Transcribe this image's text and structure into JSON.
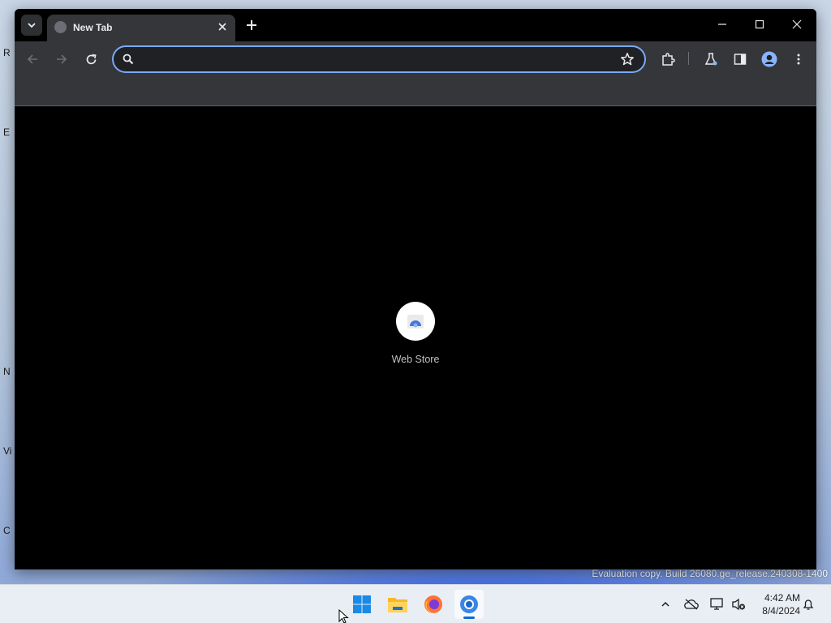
{
  "browser": {
    "tab": {
      "title": "New Tab"
    },
    "omnibox": {
      "value": "",
      "placeholder": ""
    },
    "shortcuts": [
      {
        "label": "Web Store",
        "icon": "web-store-icon"
      }
    ]
  },
  "desktop": {
    "icon_fragments": [
      "R",
      "E",
      "N",
      "Vi",
      "C"
    ],
    "watermark": "Evaluation copy. Build 26080.ge_release.240308-1400"
  },
  "taskbar": {
    "apps": [
      "windows-start-icon",
      "file-explorer-icon",
      "firefox-icon",
      "chrome-icon"
    ],
    "active_app": "chrome-icon",
    "clock": {
      "time": "4:42 AM",
      "date": "8/4/2024"
    }
  },
  "colors": {
    "tab_active": "#35363a",
    "omnibox_focus_border": "#7ca9f7",
    "accent": "#0a6cd6"
  }
}
